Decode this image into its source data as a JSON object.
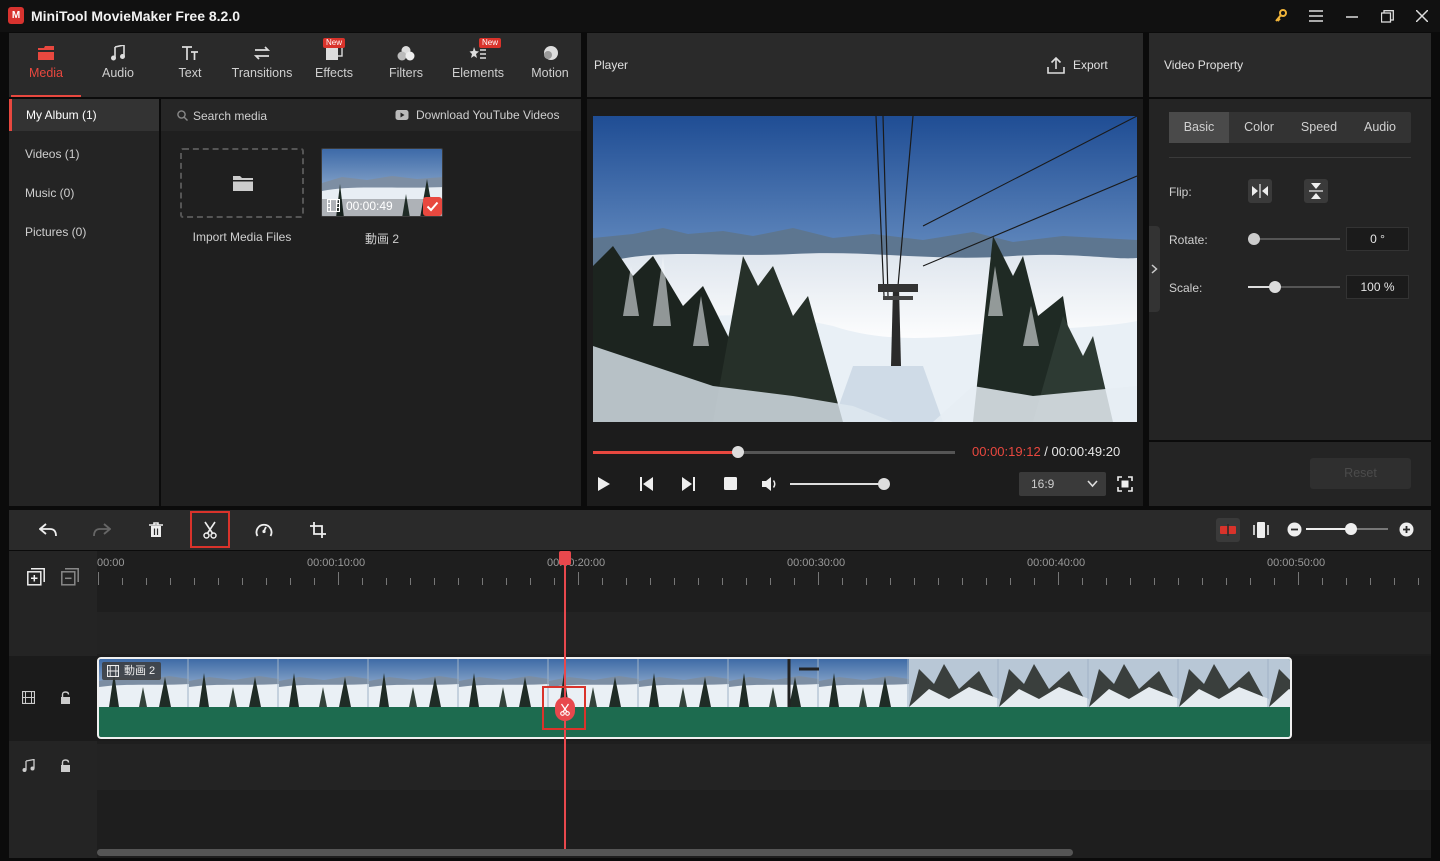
{
  "app": {
    "logo": "M",
    "title": "MiniTool MovieMaker Free 8.2.0"
  },
  "window_icons": [
    "key-icon",
    "menu-icon",
    "minimize-icon",
    "restore-icon",
    "close-icon"
  ],
  "toolbar": {
    "items": [
      {
        "label": "Media",
        "icon": "media-icon",
        "active": true
      },
      {
        "label": "Audio",
        "icon": "audio-icon"
      },
      {
        "label": "Text",
        "icon": "text-icon"
      },
      {
        "label": "Transitions",
        "icon": "transitions-icon"
      },
      {
        "label": "Effects",
        "icon": "effects-icon",
        "badge": "New"
      },
      {
        "label": "Filters",
        "icon": "filters-icon"
      },
      {
        "label": "Elements",
        "icon": "elements-icon",
        "badge": "New"
      },
      {
        "label": "Motion",
        "icon": "motion-icon"
      }
    ]
  },
  "sidebar": {
    "items": [
      {
        "label": "My Album (1)",
        "active": true
      },
      {
        "label": "Videos (1)"
      },
      {
        "label": "Music (0)"
      },
      {
        "label": "Pictures (0)"
      }
    ]
  },
  "media": {
    "search_placeholder": "Search media",
    "download_label": "Download YouTube Videos",
    "import_label": "Import Media Files",
    "clip_name": "動画 2",
    "clip_duration": "00:00:49"
  },
  "player": {
    "title": "Player",
    "export_label": "Export",
    "current_time": "00:00:19:12",
    "separator": " / ",
    "total_time": "00:00:49:20",
    "progress": 0.4,
    "volume": 1.0,
    "aspect_ratio": "16:9"
  },
  "property": {
    "title": "Video Property",
    "tabs": [
      "Basic",
      "Color",
      "Speed",
      "Audio"
    ],
    "active_tab": "Basic",
    "flip_label": "Flip:",
    "rotate_label": "Rotate:",
    "rotate_value": "0 °",
    "rotate_level": 0,
    "scale_label": "Scale:",
    "scale_value": "100 %",
    "scale_level": 0.29,
    "reset_label": "Reset"
  },
  "timeline": {
    "ruler_labels": [
      "00:00",
      "00:00:10:00",
      "00:00:20:00",
      "00:00:30:00",
      "00:00:40:00",
      "00:00:50:00"
    ],
    "clip_label": "動画 2",
    "zoom_level": 0.55
  },
  "colors": {
    "accent": "#e8483f",
    "audio_strip": "#1d6b4f"
  }
}
